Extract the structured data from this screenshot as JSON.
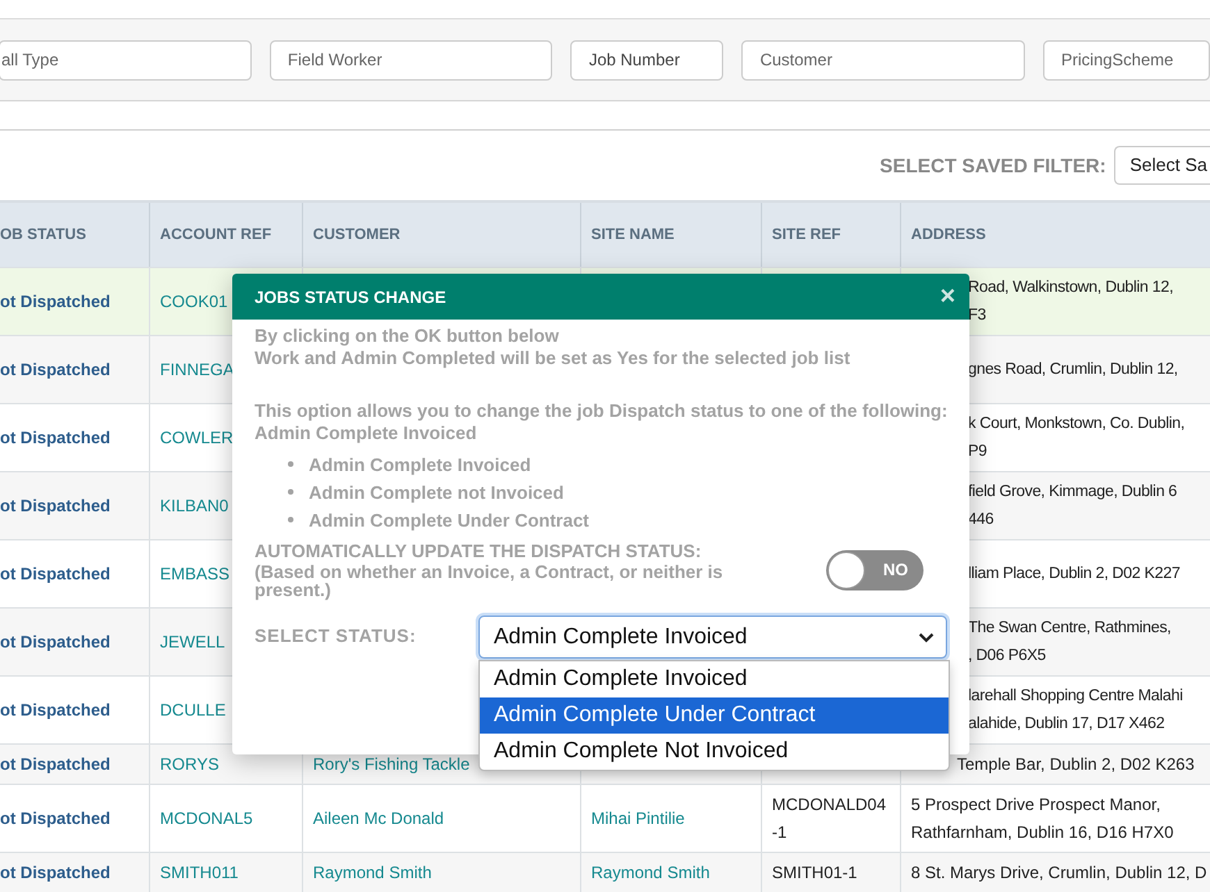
{
  "filters": [
    {
      "placeholder": "all Type"
    },
    {
      "placeholder": "Field Worker"
    },
    {
      "value": "Job Number"
    },
    {
      "placeholder": "Customer"
    },
    {
      "placeholder": "PricingScheme"
    }
  ],
  "saved_filter": {
    "label": "SELECT SAVED FILTER:",
    "value": "Select Sa"
  },
  "table": {
    "columns": [
      "OB STATUS",
      "ACCOUNT REF",
      "CUSTOMER",
      "SITE NAME",
      "SITE REF",
      "ADDRESS"
    ],
    "rows": [
      {
        "selected": true,
        "job_status": "ot Dispatched",
        "account_ref": "COOK01",
        "address": [
          "Road, Walkinstown, Dublin 12,",
          "F3"
        ]
      },
      {
        "selected": false,
        "job_status": "ot Dispatched",
        "account_ref": "FINNEGA",
        "address": [
          "gnes Road, Crumlin, Dublin 12,"
        ]
      },
      {
        "selected": false,
        "job_status": "ot Dispatched",
        "account_ref": "COWLER",
        "address": [
          "k Court, Monkstown, Co. Dublin,",
          "P9"
        ]
      },
      {
        "selected": false,
        "job_status": "ot Dispatched",
        "account_ref": "KILBAN0",
        "address": [
          "field Grove, Kimmage, Dublin 6",
          "446"
        ]
      },
      {
        "selected": false,
        "job_status": "ot Dispatched",
        "account_ref": "EMBASS",
        "address": [
          "lliam Place, Dublin 2, D02 K227"
        ]
      },
      {
        "selected": false,
        "job_status": "ot Dispatched",
        "account_ref": "JEWELL",
        "address": [
          "The Swan Centre, Rathmines,",
          ", D06 P6X5"
        ]
      },
      {
        "selected": false,
        "job_status": "ot Dispatched",
        "account_ref": "DCULLE",
        "address": [
          "larehall Shopping Centre Malahi",
          "alahide, Dublin 17, D17 X462"
        ]
      },
      {
        "selected": false,
        "job_status": "ot Dispatched",
        "account_ref": "RORYS",
        "customer": "Rory's Fishing Tackle",
        "address": [
          "Temple Bar, Dublin 2, D02 K263"
        ]
      },
      {
        "selected": false,
        "job_status": "ot Dispatched",
        "account_ref": "MCDONAL5",
        "customer": "Aileen Mc Donald",
        "site_name": "Mihai Pintilie",
        "site_ref": [
          "MCDONALD04",
          "-1"
        ],
        "address": [
          "5 Prospect Drive Prospect Manor,",
          "Rathfarnham, Dublin 16, D16 H7X0"
        ]
      },
      {
        "selected": false,
        "job_status": "ot Dispatched",
        "account_ref": "SMITH011",
        "customer": "Raymond Smith",
        "site_name": "Raymond Smith",
        "site_ref": [
          "SMITH01-1"
        ],
        "address": [
          "8 St. Marys Drive, Crumlin, Dublin 12, D"
        ]
      }
    ]
  },
  "modal": {
    "title": "JOBS STATUS CHANGE",
    "close": "×",
    "intro_lines": [
      "By clicking on the OK button below",
      "Work and Admin Completed will be set as Yes for the selected job list"
    ],
    "option_lines": [
      "This option allows you to change the job Dispatch status to one of the following:",
      "Admin Complete Invoiced"
    ],
    "bullets": [
      "Admin Complete Invoiced",
      "Admin Complete not Invoiced",
      "Admin Complete Under Contract"
    ],
    "auto_update": {
      "label": "AUTOMATICALLY UPDATE THE DISPATCH STATUS:",
      "note": "(Based on whether an Invoice, a Contract, or neither is present.)",
      "on": false,
      "toggle_text": "NO"
    },
    "status": {
      "label": "SELECT STATUS:",
      "value": "Admin Complete Invoiced",
      "options": [
        {
          "label": "Admin Complete Invoiced",
          "highlighted": false
        },
        {
          "label": "Admin Complete Under Contract",
          "highlighted": true
        },
        {
          "label": "Admin Complete Not Invoiced",
          "highlighted": false
        }
      ]
    }
  }
}
